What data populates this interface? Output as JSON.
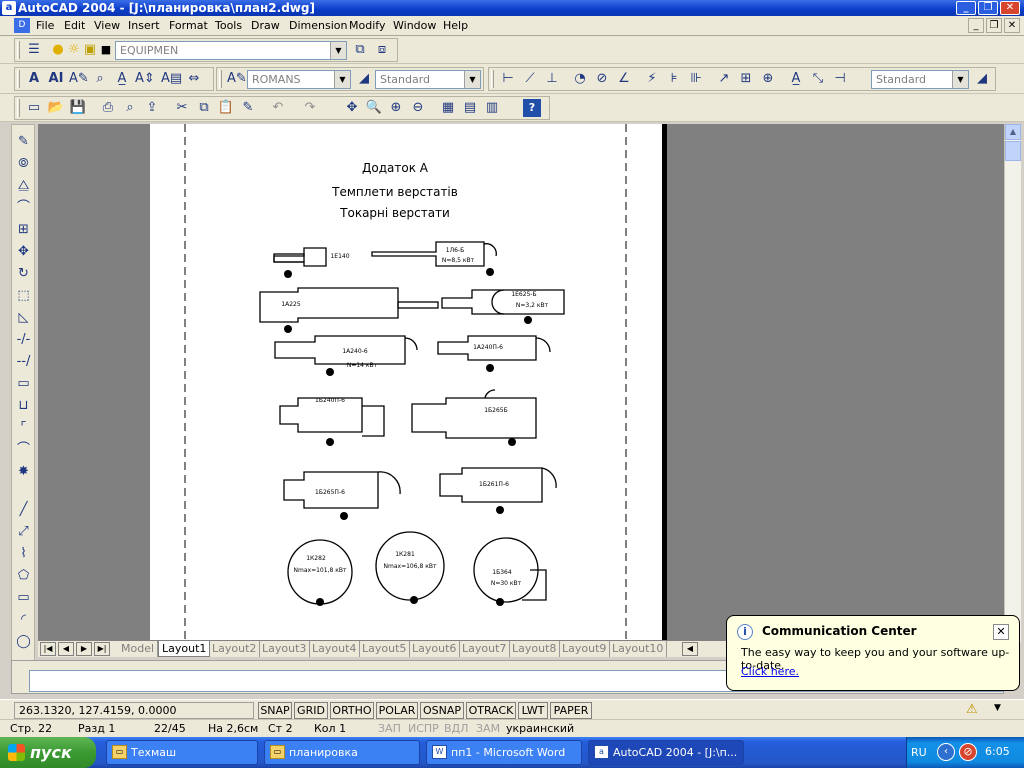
{
  "window": {
    "title": "AutoCAD 2004 - [J:\\планировка\\план2.dwg]"
  },
  "menu": [
    "File",
    "Edit",
    "View",
    "Insert",
    "Format",
    "Tools",
    "Draw",
    "Dimension",
    "Modify",
    "Window",
    "Help"
  ],
  "layer_toolbar": {
    "layer": "EQUIPMEN"
  },
  "styles_toolbar": {
    "text_style": "ROMANS",
    "dim_style": "Standard",
    "plot_style": "Standard"
  },
  "drawing": {
    "title": "Додаток А",
    "subtitle1": "Темплети верстатів",
    "subtitle2": "Токарні верстати",
    "labels": [
      "1Е140",
      "1Л6-Б",
      "N=8,5 кВт",
      "1А225",
      "1Е625-Б",
      "N=3,2 кВт",
      "1А240-6",
      "N=14 кВт",
      "1А240П-6",
      "1Б240П-6",
      "1Б265Б",
      "1Б265П-6",
      "1Б261П-6",
      "1К282",
      "Nmax=101,8 кВт",
      "1К281",
      "Nmax=106,8 кВт",
      "1Б364",
      "N=30 кВт"
    ]
  },
  "layout_tabs": [
    "Model",
    "Layout1",
    "Layout2",
    "Layout3",
    "Layout4",
    "Layout5",
    "Layout6",
    "Layout7",
    "Layout8",
    "Layout9",
    "Layout10"
  ],
  "active_tab": "Layout1",
  "status": {
    "coords": "263.1320, 127.4159, 0.0000",
    "buttons": [
      "SNAP",
      "GRID",
      "ORTHO",
      "POLAR",
      "OSNAP",
      "OTRACK",
      "LWT",
      "PAPER"
    ]
  },
  "word_status": {
    "page": "Стр. 22",
    "section": "Разд 1",
    "pages": "22/45",
    "at": "На 2,6см",
    "line": "Ст 2",
    "col": "Кол 1",
    "rec": "ЗАП",
    "trk": "ИСПР",
    "ext": "ВДЛ",
    "ovr": "ЗАМ",
    "lang": "украинский"
  },
  "balloon": {
    "title": "Communication Center",
    "body": "The easy way to keep you and your software up-to-date.",
    "link": "Click here."
  },
  "taskbar": {
    "start": "пуск",
    "tasks": [
      "Техмаш",
      "планировка",
      "пп1 - Microsoft Word",
      "AutoCAD 2004 - [J:\\п..."
    ],
    "lang": "RU",
    "clock": "6:05"
  }
}
